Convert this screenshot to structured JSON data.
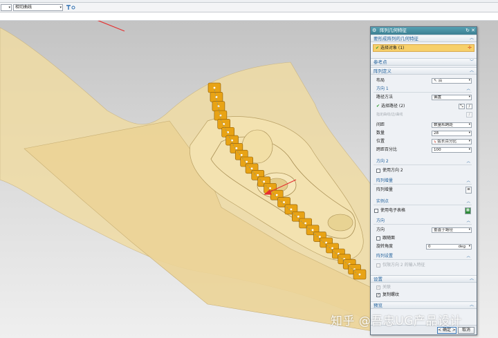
{
  "selection_bar": {
    "filter_value": "",
    "curve_rule_value": "相切曲线"
  },
  "dialog": {
    "title": "阵列几何特征",
    "geometry_section": {
      "title": "要形成阵列的几何特征",
      "select_object": "选择对象 (1)"
    },
    "reference_point": {
      "title": "参考点"
    },
    "array_definition": {
      "title": "阵列定义",
      "layout_label": "布局",
      "layout_value": "沿",
      "direction1": {
        "title": "方向 1",
        "path_method_label": "路径方法",
        "path_method_value": "偏置",
        "select_path": "选择路径 (2)",
        "select_curve": "指定曲线/边/曲线",
        "spacing_label": "间距",
        "spacing_value": "数量和跨距",
        "count_label": "数量",
        "count_value": "28",
        "position_label": "位置",
        "position_value": "弧长百分比",
        "span_percent_label": "跨距百分比",
        "span_percent_value": "100"
      },
      "direction2": {
        "title": "方向 2",
        "use_direction2": "使用方向 2"
      },
      "pattern_increment": {
        "title": "阵列增量",
        "label": "阵列增量"
      },
      "instance_points": {
        "title": "实例点",
        "use_spreadsheet": "使用电子表格"
      },
      "orientation": {
        "title": "方向",
        "orientation_label": "方向",
        "orientation_value": "垂直于路径",
        "follow_face": "跟随面",
        "rotation_label": "旋转角度",
        "rotation_value": "0",
        "rotation_unit": "deg"
      },
      "pattern_settings": {
        "title": "阵列设置",
        "only_dir2_input": "仅限方向 2 的输入特征"
      }
    },
    "settings": {
      "title": "设置",
      "associative": "关联",
      "copy_threads": "复制螺纹"
    },
    "preview": {
      "title": "预览"
    },
    "ok_button": "< 确定 >",
    "cancel_button": "取消"
  },
  "watermark": "知乎 @吾忠UG产品设计",
  "colors": {
    "accent_title": "#3c7f92",
    "section_text": "#1f5f9b",
    "selected_row": "#f7d06a",
    "part_body": "#f0dca4",
    "array_feature": "#e8a315",
    "arrow": "#e53030"
  }
}
